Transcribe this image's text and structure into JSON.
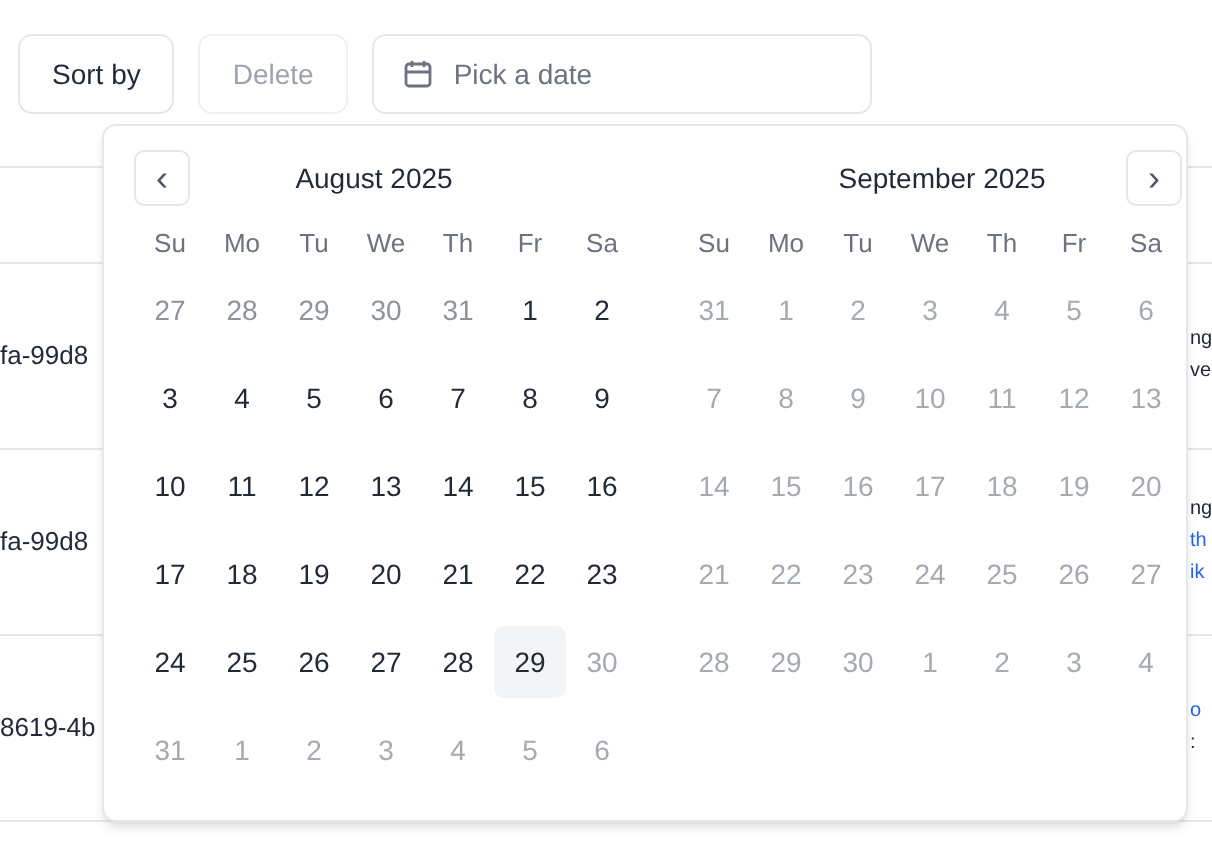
{
  "toolbar": {
    "sort_button": "Sort by",
    "delete_button": {
      "label": "Delete",
      "disabled": true
    },
    "date_field": {
      "placeholder": "Pick a date"
    }
  },
  "table": {
    "rows": [
      {
        "column_1": "fa-99d8",
        "column_last": [
          {
            "text": "ng",
            "link": false
          },
          {
            "text": "ve",
            "link": false
          }
        ]
      },
      {
        "column_1": "fa-99d8",
        "column_last": [
          {
            "text": "ng",
            "link": false
          },
          {
            "text": "th",
            "link": true
          },
          {
            "text": "ik",
            "link": true
          }
        ]
      },
      {
        "column_1": "8619-4b",
        "column_last": [
          {
            "text": "o",
            "link": true
          },
          {
            "text": ":",
            "link": false
          }
        ]
      }
    ]
  },
  "calendar": {
    "prev_button": "‹",
    "next_button": "›",
    "months": [
      {
        "title": "August 2025",
        "weekdays": [
          "Su",
          "Mo",
          "Tu",
          "We",
          "Th",
          "Fr",
          "Sa"
        ],
        "days": [
          {
            "label": "27",
            "outside": true,
            "disabled": false,
            "selected": false
          },
          {
            "label": "28",
            "outside": true,
            "disabled": false,
            "selected": false
          },
          {
            "label": "29",
            "outside": true,
            "disabled": false,
            "selected": false
          },
          {
            "label": "30",
            "outside": true,
            "disabled": false,
            "selected": false
          },
          {
            "label": "31",
            "outside": true,
            "disabled": false,
            "selected": false
          },
          {
            "label": "1",
            "outside": false,
            "disabled": false,
            "selected": false
          },
          {
            "label": "2",
            "outside": false,
            "disabled": false,
            "selected": false
          },
          {
            "label": "3",
            "outside": false,
            "disabled": false,
            "selected": false
          },
          {
            "label": "4",
            "outside": false,
            "disabled": false,
            "selected": false
          },
          {
            "label": "5",
            "outside": false,
            "disabled": false,
            "selected": false
          },
          {
            "label": "6",
            "outside": false,
            "disabled": false,
            "selected": false
          },
          {
            "label": "7",
            "outside": false,
            "disabled": false,
            "selected": false
          },
          {
            "label": "8",
            "outside": false,
            "disabled": false,
            "selected": false
          },
          {
            "label": "9",
            "outside": false,
            "disabled": false,
            "selected": false
          },
          {
            "label": "10",
            "outside": false,
            "disabled": false,
            "selected": false
          },
          {
            "label": "11",
            "outside": false,
            "disabled": false,
            "selected": false
          },
          {
            "label": "12",
            "outside": false,
            "disabled": false,
            "selected": false
          },
          {
            "label": "13",
            "outside": false,
            "disabled": false,
            "selected": false
          },
          {
            "label": "14",
            "outside": false,
            "disabled": false,
            "selected": false
          },
          {
            "label": "15",
            "outside": false,
            "disabled": false,
            "selected": false
          },
          {
            "label": "16",
            "outside": false,
            "disabled": false,
            "selected": false
          },
          {
            "label": "17",
            "outside": false,
            "disabled": false,
            "selected": false
          },
          {
            "label": "18",
            "outside": false,
            "disabled": false,
            "selected": false
          },
          {
            "label": "19",
            "outside": false,
            "disabled": false,
            "selected": false
          },
          {
            "label": "20",
            "outside": false,
            "disabled": false,
            "selected": false
          },
          {
            "label": "21",
            "outside": false,
            "disabled": false,
            "selected": false
          },
          {
            "label": "22",
            "outside": false,
            "disabled": false,
            "selected": false
          },
          {
            "label": "23",
            "outside": false,
            "disabled": false,
            "selected": false
          },
          {
            "label": "24",
            "outside": false,
            "disabled": false,
            "selected": false
          },
          {
            "label": "25",
            "outside": false,
            "disabled": false,
            "selected": false
          },
          {
            "label": "26",
            "outside": false,
            "disabled": false,
            "selected": false
          },
          {
            "label": "27",
            "outside": false,
            "disabled": false,
            "selected": false
          },
          {
            "label": "28",
            "outside": false,
            "disabled": false,
            "selected": false
          },
          {
            "label": "29",
            "outside": false,
            "disabled": false,
            "selected": true
          },
          {
            "label": "30",
            "disabled": true,
            "selected": false
          },
          {
            "label": "31",
            "disabled": true,
            "selected": false
          },
          {
            "label": "1",
            "disabled": true,
            "selected": false
          },
          {
            "label": "2",
            "disabled": true,
            "selected": false
          },
          {
            "label": "3",
            "disabled": true,
            "selected": false
          },
          {
            "label": "4",
            "disabled": true,
            "selected": false
          },
          {
            "label": "5",
            "disabled": true,
            "selected": false
          },
          {
            "label": "6",
            "disabled": true,
            "selected": false
          }
        ]
      },
      {
        "title": "September 2025",
        "weekdays": [
          "Su",
          "Mo",
          "Tu",
          "We",
          "Th",
          "Fr",
          "Sa"
        ],
        "days": [
          {
            "label": "31",
            "disabled": true,
            "selected": false
          },
          {
            "label": "1",
            "disabled": true,
            "selected": false
          },
          {
            "label": "2",
            "disabled": true,
            "selected": false
          },
          {
            "label": "3",
            "disabled": true,
            "selected": false
          },
          {
            "label": "4",
            "disabled": true,
            "selected": false
          },
          {
            "label": "5",
            "disabled": true,
            "selected": false
          },
          {
            "label": "6",
            "disabled": true,
            "selected": false
          },
          {
            "label": "7",
            "disabled": true,
            "selected": false
          },
          {
            "label": "8",
            "disabled": true,
            "selected": false
          },
          {
            "label": "9",
            "disabled": true,
            "selected": false
          },
          {
            "label": "10",
            "disabled": true,
            "selected": false
          },
          {
            "label": "11",
            "disabled": true,
            "selected": false
          },
          {
            "label": "12",
            "disabled": true,
            "selected": false
          },
          {
            "label": "13",
            "disabled": true,
            "selected": false
          },
          {
            "label": "14",
            "disabled": true,
            "selected": false
          },
          {
            "label": "15",
            "disabled": true,
            "selected": false
          },
          {
            "label": "16",
            "disabled": true,
            "selected": false
          },
          {
            "label": "17",
            "disabled": true,
            "selected": false
          },
          {
            "label": "18",
            "disabled": true,
            "selected": false
          },
          {
            "label": "19",
            "disabled": true,
            "selected": false
          },
          {
            "label": "20",
            "disabled": true,
            "selected": false
          },
          {
            "label": "21",
            "disabled": true,
            "selected": false
          },
          {
            "label": "22",
            "disabled": true,
            "selected": false
          },
          {
            "label": "23",
            "disabled": true,
            "selected": false
          },
          {
            "label": "24",
            "disabled": true,
            "selected": false
          },
          {
            "label": "25",
            "disabled": true,
            "selected": false
          },
          {
            "label": "26",
            "disabled": true,
            "selected": false
          },
          {
            "label": "27",
            "disabled": true,
            "selected": false
          },
          {
            "label": "28",
            "disabled": true,
            "selected": false
          },
          {
            "label": "29",
            "disabled": true,
            "selected": false
          },
          {
            "label": "30",
            "disabled": true,
            "selected": false
          },
          {
            "label": "1",
            "disabled": true,
            "selected": false
          },
          {
            "label": "2",
            "disabled": true,
            "selected": false
          },
          {
            "label": "3",
            "disabled": true,
            "selected": false
          },
          {
            "label": "4",
            "disabled": true,
            "selected": false
          }
        ]
      }
    ]
  }
}
